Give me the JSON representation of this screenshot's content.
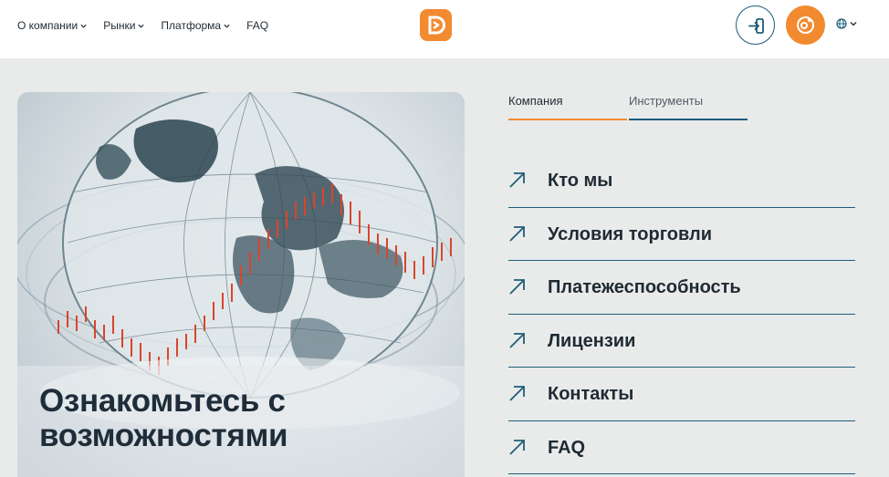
{
  "header": {
    "nav": [
      {
        "label": "О компании",
        "icon": "chevron-down-icon"
      },
      {
        "label": "Рынки",
        "icon": "chevron-down-icon"
      },
      {
        "label": "Платформа",
        "icon": "chevron-down-icon"
      },
      {
        "label": "FAQ"
      }
    ],
    "logo_icon": "brand-logo-icon",
    "login_icon": "login-icon",
    "signup_icon": "signup-icon",
    "language_icon": "globe-icon"
  },
  "hero": {
    "title_line1": "Ознакомьтесь с",
    "title_line2": "возможностями"
  },
  "tabs": [
    {
      "label": "Компания",
      "active": true
    },
    {
      "label": "Инструменты",
      "active": false
    }
  ],
  "menu": [
    {
      "label": "Кто мы",
      "icon": "arrow-up-right-icon"
    },
    {
      "label": "Условия торговли",
      "icon": "arrow-up-right-icon"
    },
    {
      "label": "Платежеспособность",
      "icon": "arrow-up-right-icon"
    },
    {
      "label": "Лицензии",
      "icon": "arrow-up-right-icon"
    },
    {
      "label": "Контакты",
      "icon": "arrow-up-right-icon"
    },
    {
      "label": "FAQ",
      "icon": "arrow-up-right-icon"
    }
  ],
  "colors": {
    "accent_orange": "#f28a30",
    "accent_teal": "#1d5d78",
    "text_dark": "#1f2a33",
    "background": "#e9ebea"
  }
}
